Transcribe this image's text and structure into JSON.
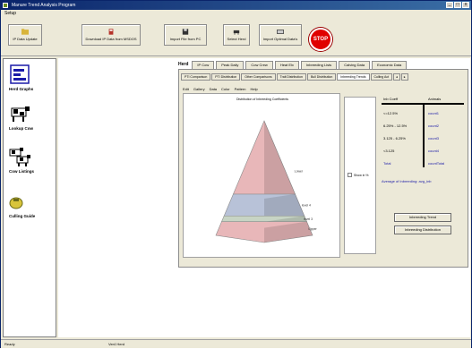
{
  "window": {
    "title": "Manure Trend Analysis Program"
  },
  "menubar": {
    "items": [
      "Setup"
    ]
  },
  "toolbar": {
    "buttons": [
      {
        "label": "IP Data Update",
        "icon": "folder-icon"
      },
      {
        "label": "Download IP Data from MSDOS",
        "icon": "download-icon"
      },
      {
        "label": "Import File from PC",
        "icon": "save-icon"
      },
      {
        "label": "Select Herd",
        "icon": "herd-icon"
      },
      {
        "label": "Import Optimal Data's",
        "icon": "import-icon"
      }
    ],
    "stop_label": "STOP"
  },
  "sidebar": {
    "items": [
      {
        "label": "Herd Graphs",
        "icon": "chart-icon"
      },
      {
        "label": "Lookup Cow",
        "icon": "cow-icon"
      },
      {
        "label": "Cow Listings",
        "icon": "cows-icon"
      },
      {
        "label": "Culling Guide",
        "icon": "culling-icon"
      }
    ]
  },
  "outer_tabs": {
    "label": "Herd",
    "items": [
      "IP Cow",
      "Peak Daily",
      "Cow Crew",
      "Heat Elx",
      "Inbreeding Lists",
      "Calving Data",
      "Economic Data"
    ]
  },
  "inner_tabs": {
    "items": [
      "PTI Comparison",
      "PTI Distribution",
      "Other Comparisons",
      "Trait Distribution",
      "Bull Distribution",
      "Inbreeding Trends",
      "Culling Act"
    ],
    "active": 5
  },
  "submenu": {
    "items": [
      "Edit",
      "Gallery",
      "Data",
      "Color",
      "Pattern",
      "Help"
    ]
  },
  "chart_data": {
    "type": "pyramid",
    "title": "Distribution of Inbreeding Coefficients",
    "layers": [
      {
        "label": "Lower",
        "color": "#e8b7b9"
      },
      {
        "label": "level 4",
        "color": "#b8c2d8"
      },
      {
        "label": "level 3",
        "color": "#c7d4c4"
      },
      {
        "label": "Upper",
        "color": "#e8b7b9"
      }
    ]
  },
  "legend": {
    "option_label": "Show in %"
  },
  "class_table": {
    "headers": [
      "Inb Coeff",
      "Animals"
    ],
    "rows": [
      {
        "range": "<=12.5%",
        "count": "count1"
      },
      {
        "range": "6.25% - 12.5%",
        "count": "count2"
      },
      {
        "range": "3.125 - 6.25%",
        "count": "count3"
      },
      {
        "range": "<3.125",
        "count": "count4"
      },
      {
        "range": "Total",
        "count": "countTotal"
      }
    ]
  },
  "stat_text": "Average of Inbreeding: avg_inb",
  "buttons": {
    "trend": "Inbreeding Trend",
    "distribution": "Inbreeding Distribution"
  },
  "statusbar": {
    "left": "Ready",
    "right": "Ver4 Herd"
  }
}
